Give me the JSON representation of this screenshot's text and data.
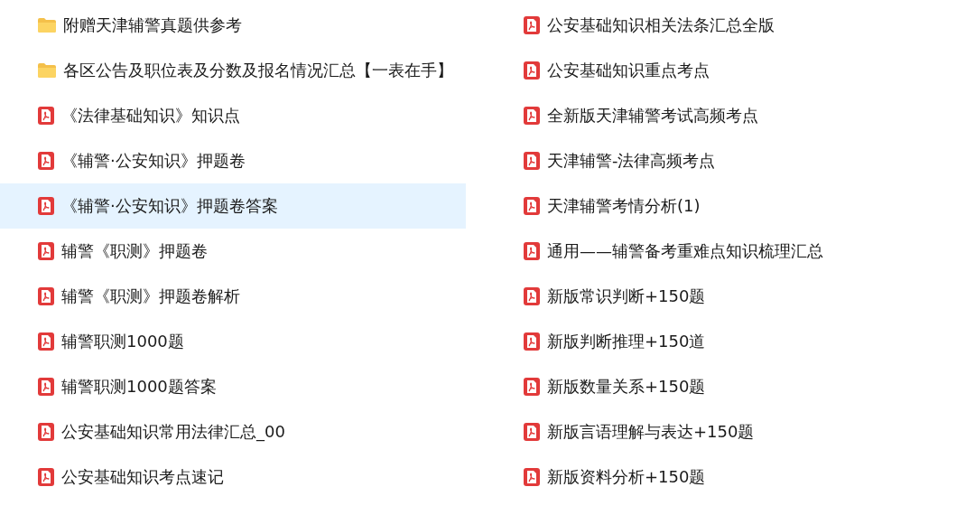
{
  "columns": [
    {
      "items": [
        {
          "kind": "folder",
          "name": "附赠天津辅警真题供参考",
          "selected": false
        },
        {
          "kind": "folder",
          "name": "各区公告及职位表及分数及报名情况汇总【一表在手】",
          "selected": false
        },
        {
          "kind": "pdf",
          "name": "《法律基础知识》知识点",
          "selected": false
        },
        {
          "kind": "pdf",
          "name": "《辅警·公安知识》押题卷",
          "selected": false
        },
        {
          "kind": "pdf",
          "name": "《辅警·公安知识》押题卷答案",
          "selected": true
        },
        {
          "kind": "pdf",
          "name": "辅警《职测》押题卷",
          "selected": false
        },
        {
          "kind": "pdf",
          "name": "辅警《职测》押题卷解析",
          "selected": false
        },
        {
          "kind": "pdf",
          "name": "辅警职测1000题",
          "selected": false
        },
        {
          "kind": "pdf",
          "name": "辅警职测1000题答案",
          "selected": false
        },
        {
          "kind": "pdf",
          "name": "公安基础知识常用法律汇总_00",
          "selected": false
        },
        {
          "kind": "pdf",
          "name": "公安基础知识考点速记",
          "selected": false
        }
      ]
    },
    {
      "items": [
        {
          "kind": "pdf",
          "name": "公安基础知识相关法条汇总全版",
          "selected": false
        },
        {
          "kind": "pdf",
          "name": "公安基础知识重点考点",
          "selected": false
        },
        {
          "kind": "pdf",
          "name": "全新版天津辅警考试高频考点",
          "selected": false
        },
        {
          "kind": "pdf",
          "name": "天津辅警-法律高频考点",
          "selected": false
        },
        {
          "kind": "pdf",
          "name": "天津辅警考情分析(1)",
          "selected": false
        },
        {
          "kind": "pdf",
          "name": "通用——辅警备考重难点知识梳理汇总",
          "selected": false
        },
        {
          "kind": "pdf",
          "name": "新版常识判断+150题",
          "selected": false
        },
        {
          "kind": "pdf",
          "name": "新版判断推理+150道",
          "selected": false
        },
        {
          "kind": "pdf",
          "name": "新版数量关系+150题",
          "selected": false
        },
        {
          "kind": "pdf",
          "name": "新版言语理解与表达+150题",
          "selected": false
        },
        {
          "kind": "pdf",
          "name": "新版资料分析+150题",
          "selected": false
        }
      ]
    }
  ]
}
